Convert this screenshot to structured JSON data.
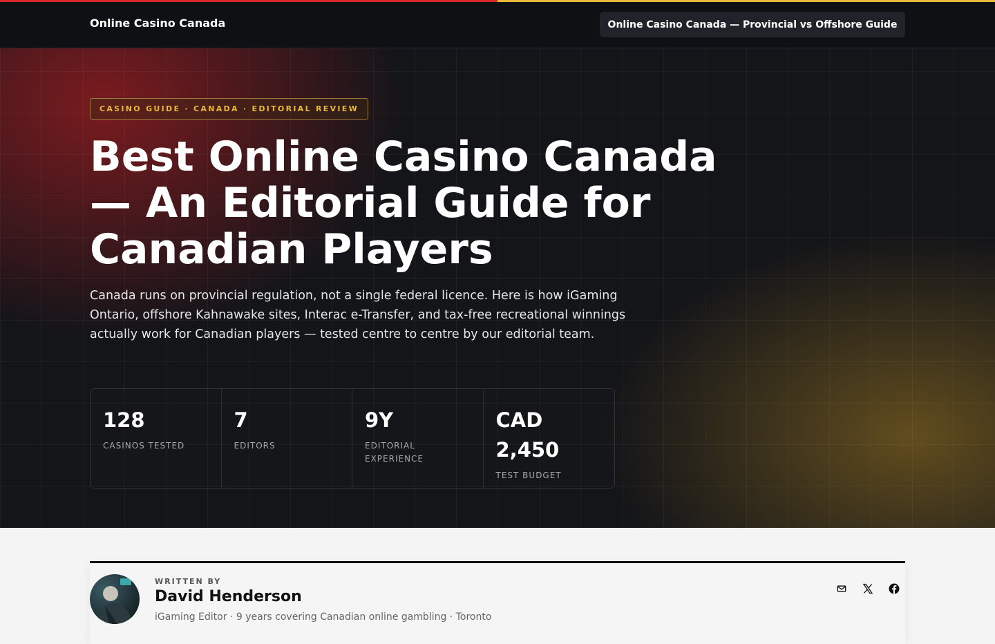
{
  "header": {
    "brand": "Online Casino Canada",
    "pill": "Online Casino Canada — Provincial vs Offshore Guide"
  },
  "hero": {
    "badge": "CASINO GUIDE · CANADA · EDITORIAL REVIEW",
    "headline": "Best Online Casino Canada — An Editorial Guide for Canadian Players",
    "lede": "Canada runs on provincial regulation, not a single federal licence. Here is how iGaming Ontario, offshore Kahnawake sites, Interac e-Transfer, and tax-free recreational winnings actually work for Canadian players — tested centre to centre by our editorial team.",
    "stats": [
      {
        "value": "128",
        "label": "Casinos tested"
      },
      {
        "value": "7",
        "label": "Editors"
      },
      {
        "value": "9Y",
        "label": "Editorial experience"
      },
      {
        "value": "CAD 2,450",
        "label": "Test budget"
      }
    ]
  },
  "author": {
    "written_by": "WRITTEN BY",
    "name": "David Henderson",
    "meta": "iGaming Editor · 9 years covering Canadian online gambling · Toronto",
    "social": [
      "mail-icon",
      "x-icon",
      "facebook-icon"
    ]
  },
  "colors": {
    "accent_red": "#d7262b",
    "accent_gold": "#e8b93a",
    "dark": "#0e1014"
  }
}
